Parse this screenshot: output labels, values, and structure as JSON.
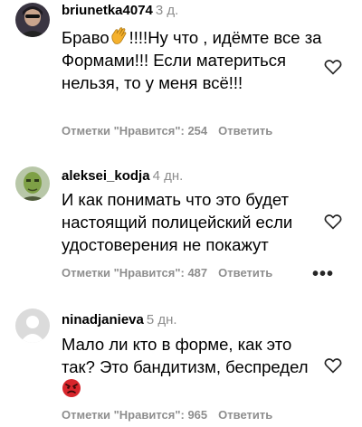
{
  "comments": [
    {
      "username": "briunetka4074",
      "time": "3 д.",
      "text_before_emoji": "Браво",
      "emoji": "clapping-hands",
      "text_after_emoji": "!!!!Ну что , идёмте все за Формами!!! Если материться нельзя, то у меня всё!!!",
      "likes_label": "Отметки \"Нравится\": 254",
      "reply_label": "Ответить"
    },
    {
      "username": "aleksei_kodja",
      "time": "4 дн.",
      "text": "И как понимать что это будет настоящий полицейский если удостоверения не покажут",
      "likes_label": "Отметки \"Нравится\": 487",
      "reply_label": "Ответить",
      "more_label": "•••"
    },
    {
      "username": "ninadjanieva",
      "time": "5 дн.",
      "text": "Мало ли кто в форме, как это так? Это бандитизм, беспредел",
      "emoji": "angry-face",
      "likes_label": "Отметки \"Нравится\": 965",
      "reply_label": "Ответить"
    }
  ],
  "colors": {
    "secondary_text": "#8e8e8e",
    "primary_text": "#000000",
    "angry_emoji": "#d7262c",
    "clap_emoji": "#f5b12d"
  }
}
